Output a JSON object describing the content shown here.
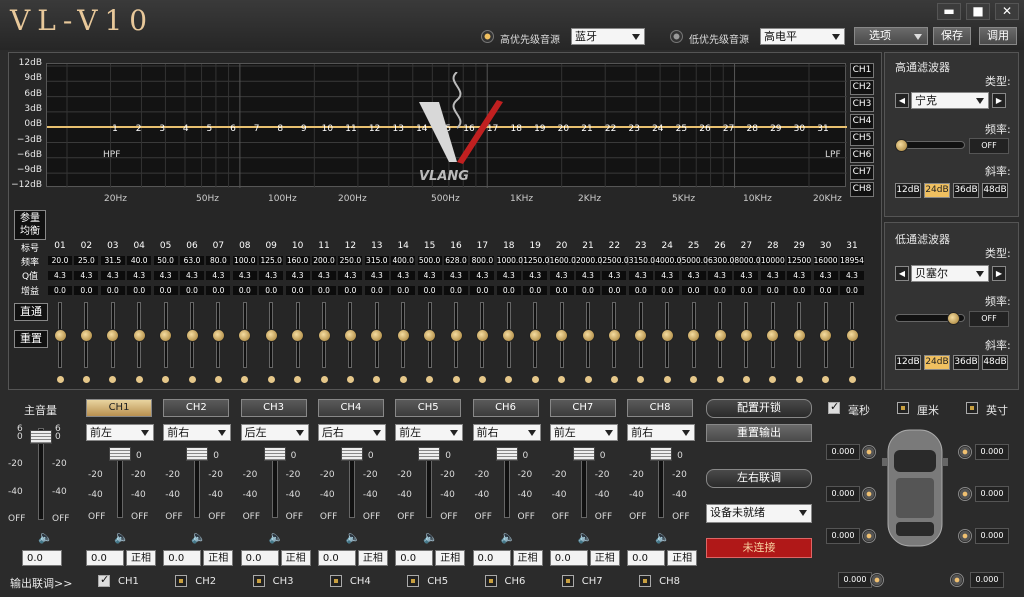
{
  "app": {
    "title": "VL-V10"
  },
  "window": {
    "min": "▬",
    "max": "■",
    "close": "✕"
  },
  "header": {
    "high_source_label": "高优先级音源",
    "high_source_value": "蓝牙",
    "low_source_label": "低优先级音源",
    "low_source_value": "高电平",
    "options": "选项",
    "save": "保存",
    "recall": "调用"
  },
  "graph": {
    "db_labels": [
      "12dB",
      "9dB",
      "6dB",
      "3dB",
      "0dB",
      "−3dB",
      "−6dB",
      "−9dB",
      "−12dB"
    ],
    "freq_labels": [
      "20Hz",
      "50Hz",
      "100Hz",
      "200Hz",
      "500Hz",
      "1KHz",
      "2KHz",
      "5KHz",
      "10KHz",
      "20KHz"
    ],
    "hpf": "HPF",
    "lpf": "LPF",
    "logo": "VLANG",
    "band_numbers": [
      "1",
      "2",
      "3",
      "4",
      "5",
      "6",
      "7",
      "8",
      "9",
      "10",
      "11",
      "12",
      "13",
      "14",
      "15",
      "16",
      "17",
      "18",
      "19",
      "20",
      "21",
      "22",
      "23",
      "24",
      "25",
      "26",
      "27",
      "28",
      "29",
      "30",
      "31"
    ]
  },
  "channels_side": [
    "CH1",
    "CH2",
    "CH3",
    "CH4",
    "CH5",
    "CH6",
    "CH7",
    "CH8"
  ],
  "hpf": {
    "title": "高通滤波器",
    "type_label": "类型:",
    "type": "宁克",
    "freq_label": "频率:",
    "freq": "OFF",
    "slope_label": "斜率:",
    "slopes": [
      "12dB",
      "24dB",
      "36dB",
      "48dB"
    ],
    "slope_selected": 1
  },
  "lpf": {
    "title": "低通滤波器",
    "type_label": "类型:",
    "type": "贝塞尔",
    "freq_label": "频率:",
    "freq": "OFF",
    "slope_label": "斜率:",
    "slopes": [
      "12dB",
      "24dB",
      "36dB",
      "48dB"
    ],
    "slope_selected": 1
  },
  "eq": {
    "ref_label_1": "参量",
    "ref_label_2": "均衡",
    "row_labels": [
      "标号",
      "频率",
      "Q值",
      "增益"
    ],
    "bypass": "直通",
    "reset": "重置",
    "index": [
      "01",
      "02",
      "03",
      "04",
      "05",
      "06",
      "07",
      "08",
      "09",
      "10",
      "11",
      "12",
      "13",
      "14",
      "15",
      "16",
      "17",
      "18",
      "19",
      "20",
      "21",
      "22",
      "23",
      "24",
      "25",
      "26",
      "27",
      "28",
      "29",
      "30",
      "31"
    ],
    "freq": [
      "20.0",
      "25.0",
      "31.5",
      "40.0",
      "50.0",
      "63.0",
      "80.0",
      "100.0",
      "125.0",
      "160.0",
      "200.0",
      "250.0",
      "315.0",
      "400.0",
      "500.0",
      "628.0",
      "800.0",
      "1000.0",
      "1250.0",
      "1600.0",
      "2000.0",
      "2500.0",
      "3150.0",
      "4000.0",
      "5000.0",
      "6300.0",
      "8000.0",
      "10000",
      "12500",
      "16000",
      "18954"
    ],
    "q": "4.3",
    "gain": "0.0"
  },
  "output": {
    "master_label": "主音量",
    "master_value": "0.0",
    "scale_top": "6",
    "scale": [
      "0",
      "-20",
      "-40",
      "OFF"
    ],
    "phase": "正相",
    "link_label": "输出联调>>",
    "channels": [
      {
        "name": "CH1",
        "pos": "前左",
        "val": "0.0",
        "checked": true
      },
      {
        "name": "CH2",
        "pos": "前右",
        "val": "0.0",
        "checked": false
      },
      {
        "name": "CH3",
        "pos": "后左",
        "val": "0.0",
        "checked": false
      },
      {
        "name": "CH4",
        "pos": "后右",
        "val": "0.0",
        "checked": false
      },
      {
        "name": "CH5",
        "pos": "前左",
        "val": "0.0",
        "checked": false
      },
      {
        "name": "CH6",
        "pos": "前右",
        "val": "0.0",
        "checked": false
      },
      {
        "name": "CH7",
        "pos": "前左",
        "val": "0.0",
        "checked": false
      },
      {
        "name": "CH8",
        "pos": "前右",
        "val": "0.0",
        "checked": false
      }
    ]
  },
  "config": {
    "lock": "配置开锁",
    "reset_out": "重置输出",
    "lr_link": "左右联调",
    "device": "设备未就绪",
    "connect": "未连接"
  },
  "delay": {
    "units": [
      "毫秒",
      "厘米",
      "英寸"
    ],
    "values": [
      "0.000",
      "0.000",
      "0.000",
      "0.000",
      "0.000",
      "0.000",
      "0.000",
      "0.000"
    ]
  },
  "colors": {
    "accent": "#f0c060",
    "connect_bg": "#b01818"
  }
}
